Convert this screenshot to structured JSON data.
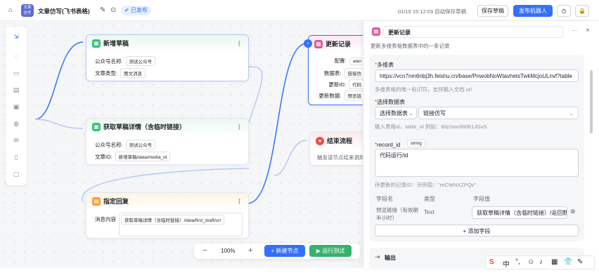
{
  "topbar": {
    "app_badge": "文章 仿写",
    "title": "文章仿写(飞书表格)",
    "status": "已发布",
    "autosave": "01/15 15:12:03 自动保存草稿",
    "save_draft": "保存草稿",
    "publish_bot": "发布机器人"
  },
  "nodes": {
    "add_draft": {
      "title": "新增草稿",
      "row1_label": "公众号名称:",
      "row1_chip": "测试公众号",
      "row2_label": "文章类型:",
      "row2_chip": "图文消息"
    },
    "get_draft": {
      "title": "获取草稿详情（含临时链接）",
      "row1_label": "公众号名称:",
      "row1_chip": "测试公众号",
      "row2_label": "文章ID:",
      "row2_chip": "新增草稿/data/media_id"
    },
    "reply": {
      "title": "指定回复",
      "row1_label": "消息内容",
      "row1_chip": "获取草稿详情（含临时链接）/data/first_draft/url"
    },
    "update": {
      "title": "更新记录",
      "config": "配置:",
      "config_chip": "alan",
      "table": "数据表:",
      "table_chip": "链接仿",
      "record": "更新ID:",
      "record_chip": "代码",
      "data": "更新数据:",
      "data_chip": "预览链"
    },
    "end": {
      "title": "结束流程",
      "desc": "触发该节点结束调用"
    }
  },
  "zoom": {
    "minus": "−",
    "level": "100%",
    "plus": "+",
    "new_node": "+ 新建节点",
    "run_test": "▶ 运行测试"
  },
  "panel": {
    "title": "更新记录",
    "subtitle": "更新多维表格数据表中的一条记录",
    "sheet_label": "多维表",
    "sheet_value": "https://vcn7nm6nbj3h.feishu.cn/base/PnwobNoWtavhetsTwkMcjoULnvf?table",
    "sheet_hint": "多维表格的唯一标识符，支持输入文档 url",
    "table_label": "选择数据表",
    "table_mode": "选择数据表",
    "table_value": "链接仿写",
    "table_hint": "输入表格id，table_id 例如：tblz2wmlWiB1JGxS",
    "record_label": "record_id",
    "record_type": "string",
    "record_value": "代码运行/id",
    "record_hint": "待更新的记录ID：示例值：\"reCWNXZPQv\"",
    "col_name": "字段名",
    "col_type": "类型",
    "col_value": "字段值",
    "field_name": "预览链接（有效期半小时）",
    "field_type": "Text",
    "field_value": "获取草稿详情（含临时链接）/返回数",
    "add_field": "+ 添加字段",
    "output": "输出"
  },
  "ime": {
    "items": [
      "S",
      "中",
      "°,",
      "☺",
      "♪",
      "▦",
      "👕",
      "✎"
    ]
  }
}
